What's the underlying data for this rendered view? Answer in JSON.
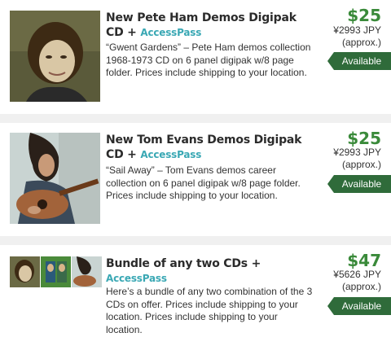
{
  "products": [
    {
      "title": "New Pete Ham Demos Digipak CD +",
      "access_label": "AccessPass",
      "description": "“Gwent Gardens” – Pete Ham demos collection 1968-1973 CD on 6 panel digipak w/8 page folder. Prices include shipping to your location.",
      "price": "$25",
      "jpy": "¥2993 JPY",
      "approx": "(approx.)",
      "status": "Available"
    },
    {
      "title": "New Tom Evans Demos Digipak CD +",
      "access_label": "AccessPass",
      "description": "“Sail Away” – Tom Evans demos career collection on 6 panel digipak w/8 page folder. Prices include shipping to your location.",
      "price": "$25",
      "jpy": "¥2993 JPY",
      "approx": "(approx.)",
      "status": "Available"
    },
    {
      "title": "Bundle of any two CDs +",
      "access_label": "AccessPass",
      "description": "Here’s a bundle of any two combination of the 3 CDs on offer. Prices include shipping to your location. Prices include shipping to your location.",
      "price": "$47",
      "jpy": "¥5626 JPY",
      "approx": "(approx.)",
      "status": "Available"
    }
  ],
  "colors": {
    "price": "#3a8a3a",
    "badge": "#2f6b3a",
    "access": "#3aa8b4"
  }
}
